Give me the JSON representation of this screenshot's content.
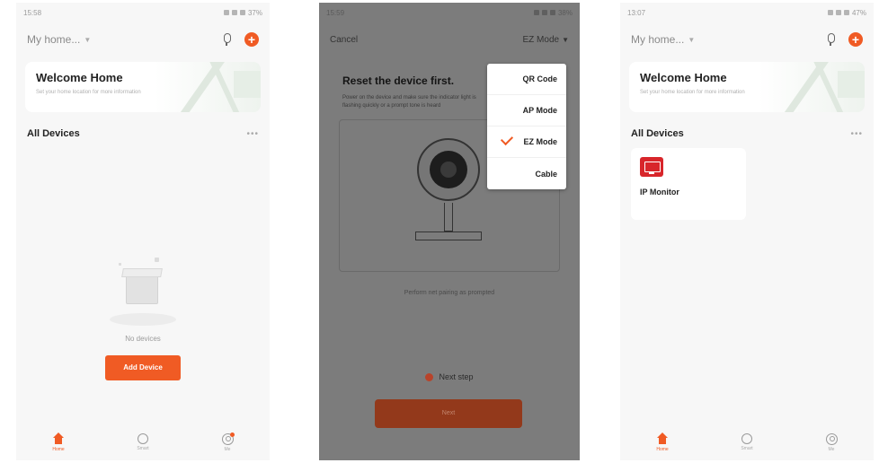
{
  "screen1": {
    "status_time": "15:58",
    "status_battery": "37%",
    "home_selector": "My home...",
    "welcome_title": "Welcome Home",
    "welcome_subtitle": "Set your home location for more information",
    "all_devices": "All Devices",
    "no_devices": "No devices",
    "add_device": "Add Device",
    "tabs": [
      {
        "label": "Home",
        "active": true
      },
      {
        "label": "Smart",
        "active": false
      },
      {
        "label": "Me",
        "active": false
      }
    ]
  },
  "screen2": {
    "status_time": "15:59",
    "status_battery": "38%",
    "cancel": "Cancel",
    "mode_selector": "EZ Mode",
    "title": "Reset the device first.",
    "description": "Power on the device and make sure the indicator light is flashing quickly or a prompt tone is heard",
    "perform_text": "Perform net pairing as prompted",
    "next_step": "Next step",
    "next_button": "Next",
    "dropdown": [
      {
        "label": "QR Code",
        "checked": false
      },
      {
        "label": "AP Mode",
        "checked": false
      },
      {
        "label": "EZ Mode",
        "checked": true
      },
      {
        "label": "Cable",
        "checked": false
      }
    ]
  },
  "screen3": {
    "status_time": "13:07",
    "status_battery": "47%",
    "home_selector": "My home...",
    "welcome_title": "Welcome Home",
    "welcome_subtitle": "Set your home location for more information",
    "all_devices": "All Devices",
    "device_name": "IP Monitor",
    "tabs": [
      {
        "label": "Home",
        "active": true
      },
      {
        "label": "Smart",
        "active": false
      },
      {
        "label": "Me",
        "active": false
      }
    ]
  },
  "colors": {
    "accent": "#f05b24",
    "device_icon": "#d8262b"
  },
  "icons": [
    "mic-icon",
    "plus-icon",
    "more-icon",
    "home-icon",
    "scene-icon",
    "me-icon",
    "check-icon",
    "monitor-icon",
    "box-icon",
    "chevron-down-icon"
  ]
}
